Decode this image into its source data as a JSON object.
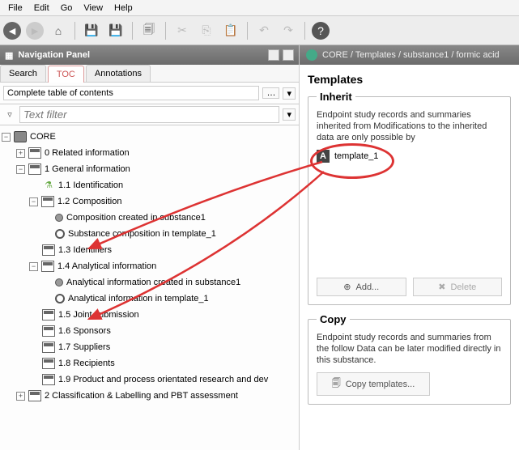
{
  "menu": {
    "file": "File",
    "edit": "Edit",
    "go": "Go",
    "view": "View",
    "help": "Help"
  },
  "nav": {
    "title": "Navigation Panel",
    "tabs": {
      "search": "Search",
      "toc": "TOC",
      "annotations": "Annotations"
    },
    "toc_dropdown": "Complete table of contents",
    "filter_placeholder": "Text filter"
  },
  "tree": {
    "core": "CORE",
    "n0": "0 Related information",
    "n1": "1 General information",
    "n11": "1.1 Identification",
    "n12": "1.2 Composition",
    "n12a": "Composition created in substance1",
    "n12b": "Substance composition in template_1",
    "n13": "1.3 Identifiers",
    "n14": "1.4 Analytical information",
    "n14a": "Analytical information created in substance1",
    "n14b": "Analytical information in template_1",
    "n15": "1.5 Joint submission",
    "n16": "1.6 Sponsors",
    "n17": "1.7 Suppliers",
    "n18": "1.8 Recipients",
    "n19": "1.9 Product and process orientated research and dev",
    "n2": "2 Classification & Labelling and PBT assessment"
  },
  "breadcrumb": "CORE / Templates / substance1 / formic acid",
  "templates": {
    "heading": "Templates",
    "inherit_legend": "Inherit",
    "inherit_text": "Endpoint study records and summaries inherited from Modifications to the inherited data are only possible by",
    "item": "template_1",
    "add": "Add...",
    "delete": "Delete",
    "copy_legend": "Copy",
    "copy_text": "Endpoint study records and summaries from the follow Data can be later modified directly in this substance.",
    "copy_btn": "Copy templates..."
  }
}
